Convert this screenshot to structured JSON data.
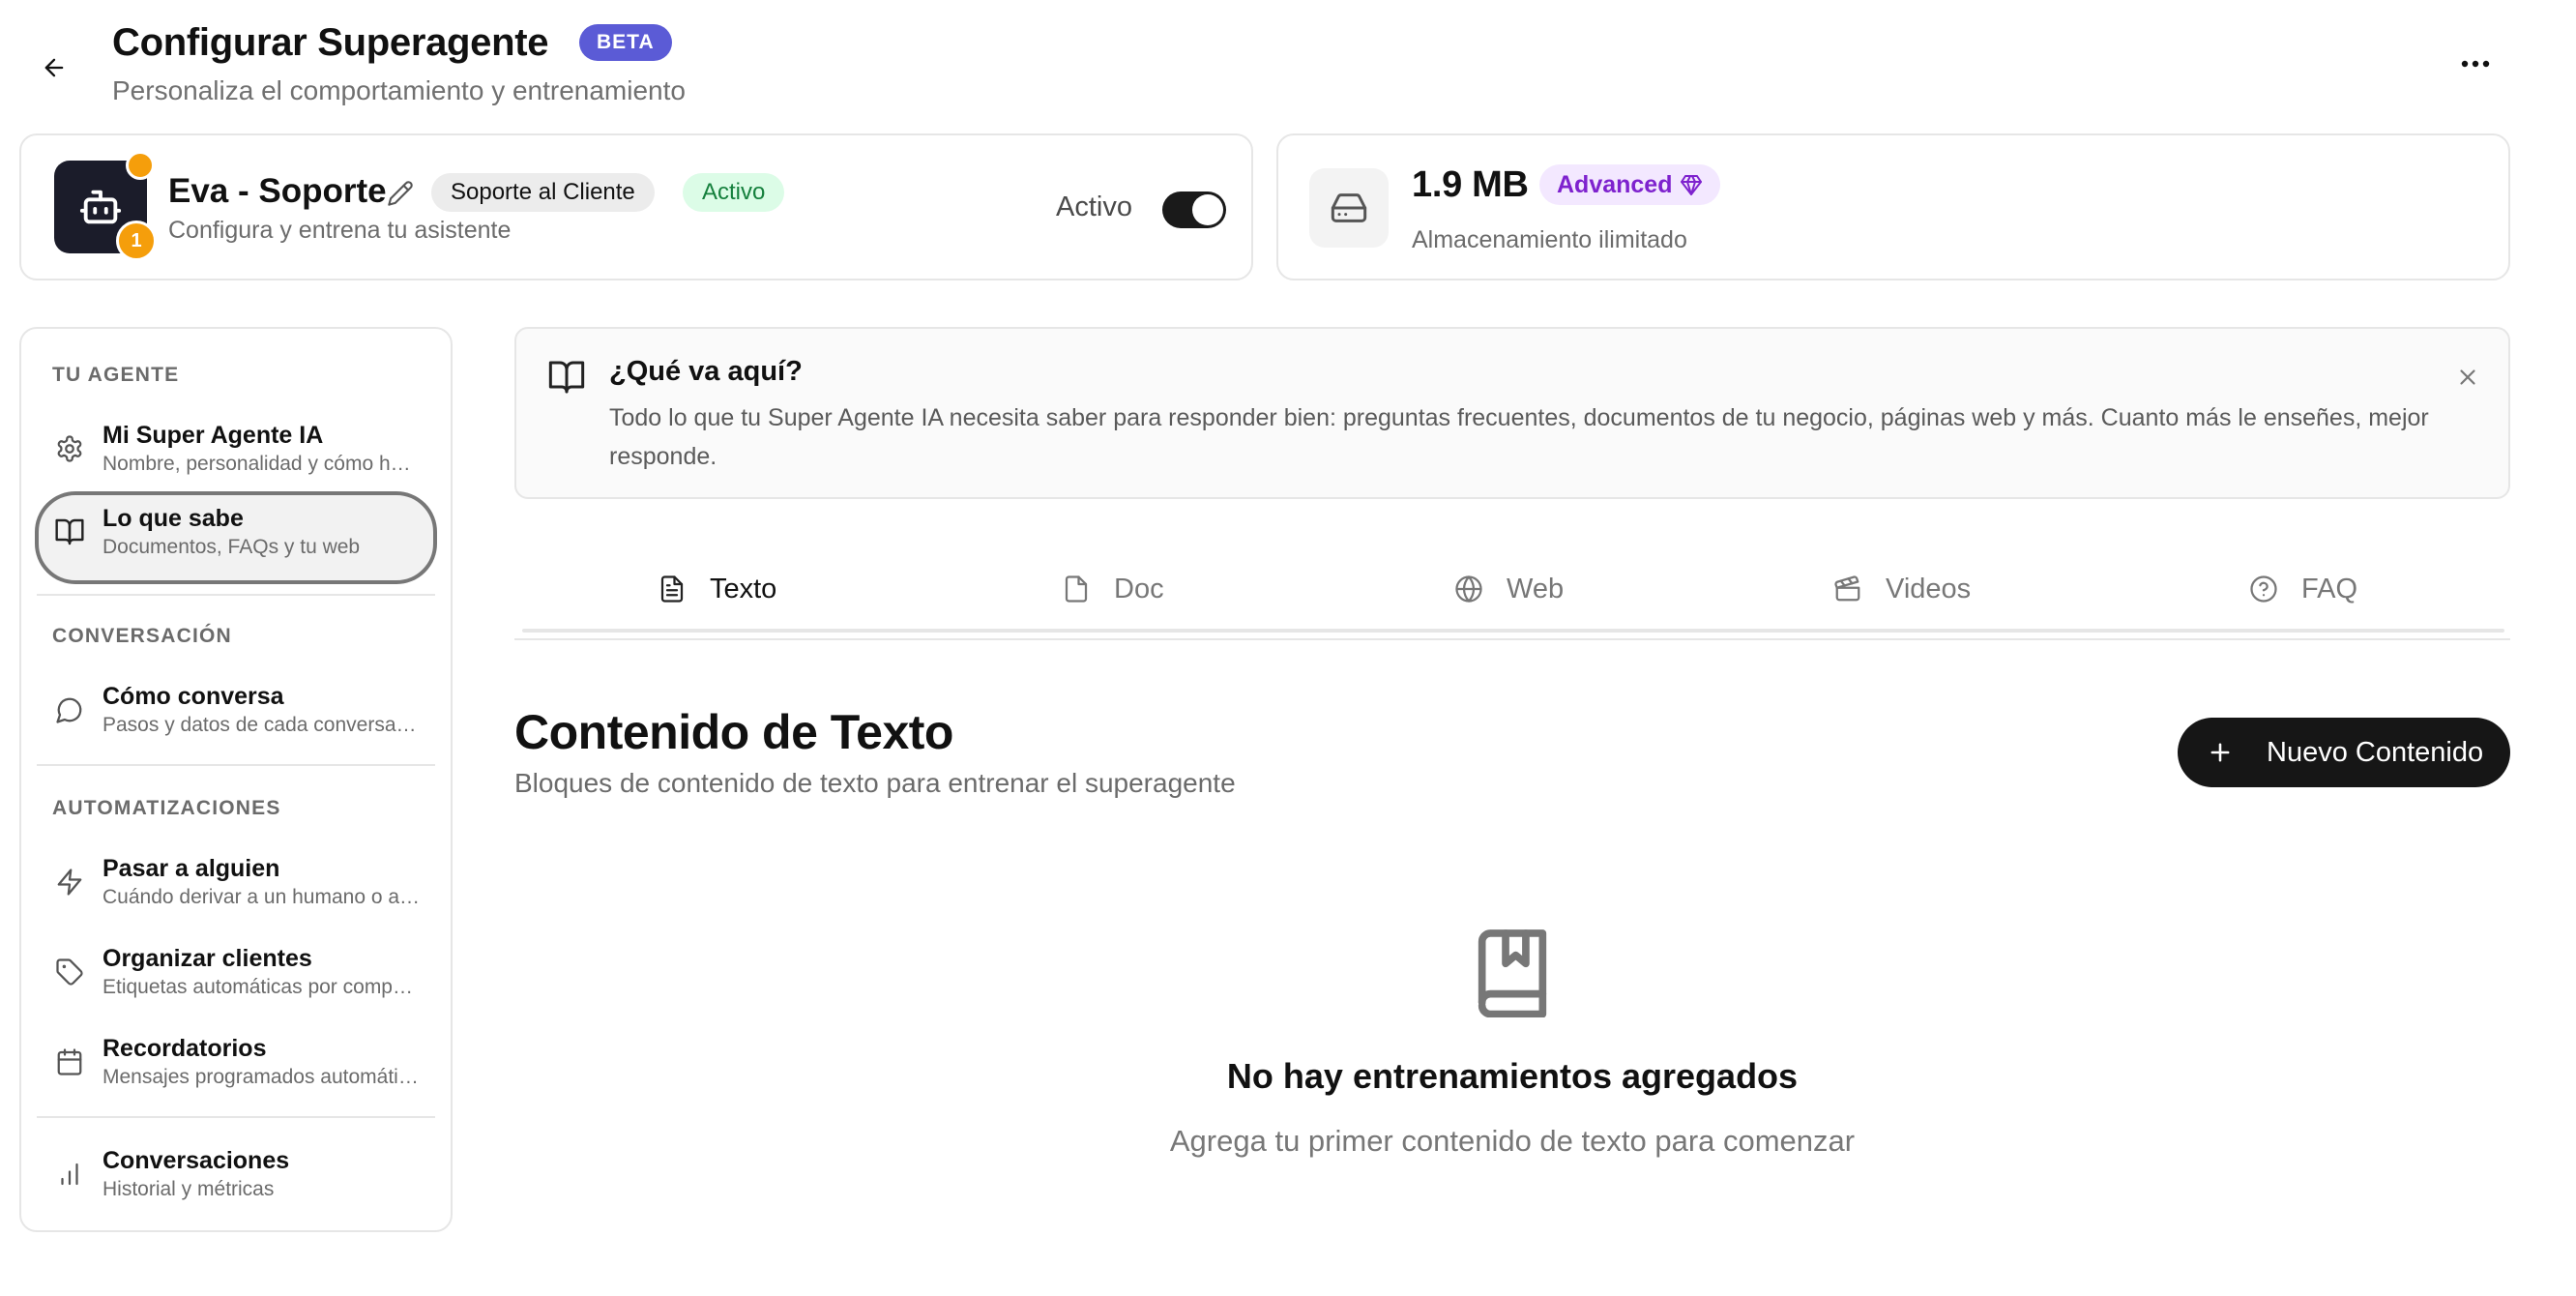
{
  "header": {
    "title": "Configurar Superagente",
    "badge": "BETA",
    "subtitle": "Personaliza el comportamiento y entrenamiento"
  },
  "agent": {
    "name": "Eva - Soporte",
    "category": "Soporte al Cliente",
    "status": "Activo",
    "description": "Configura y entrena tu asistente",
    "notification_count": "1",
    "toggle_label": "Activo",
    "toggle_on": true
  },
  "storage": {
    "size": "1.9 MB",
    "plan": "Advanced",
    "description": "Almacenamiento ilimitado"
  },
  "sidebar": {
    "sections": [
      {
        "label": "TU AGENTE"
      },
      {
        "label": "CONVERSACIÓN"
      },
      {
        "label": "AUTOMATIZACIONES"
      }
    ],
    "items": [
      {
        "title": "Mi Super Agente IA",
        "subtitle": "Nombre, personalidad y cómo habla",
        "icon": "gear-icon"
      },
      {
        "title": "Lo que sabe",
        "subtitle": "Documentos, FAQs y tu web",
        "icon": "book-icon",
        "active": true
      },
      {
        "title": "Cómo conversa",
        "subtitle": "Pasos y datos de cada conversación",
        "icon": "chat-bubble-icon"
      },
      {
        "title": "Pasar a alguien",
        "subtitle": "Cuándo derivar a un humano o agente",
        "icon": "lightning-icon"
      },
      {
        "title": "Organizar clientes",
        "subtitle": "Etiquetas automáticas por comportamiento",
        "icon": "tag-icon"
      },
      {
        "title": "Recordatorios",
        "subtitle": "Mensajes programados automáticamente",
        "icon": "calendar-icon"
      },
      {
        "title": "Conversaciones",
        "subtitle": "Historial y métricas",
        "icon": "bar-chart-icon"
      }
    ]
  },
  "info": {
    "title": "¿Qué va aquí?",
    "text": "Todo lo que tu Super Agente IA necesita saber para responder bien: preguntas frecuentes, documentos de tu negocio, páginas web y más. Cuanto más le enseñes, mejor responde."
  },
  "tabs": [
    {
      "label": "Texto",
      "icon": "file-text-icon",
      "active": true
    },
    {
      "label": "Doc",
      "icon": "file-icon"
    },
    {
      "label": "Web",
      "icon": "globe-icon"
    },
    {
      "label": "Videos",
      "icon": "clapperboard-icon"
    },
    {
      "label": "FAQ",
      "icon": "help-circle-icon"
    }
  ],
  "content": {
    "title": "Contenido de Texto",
    "subtitle": "Bloques de contenido de texto para entrenar el superagente",
    "new_button": "Nuevo Contenido"
  },
  "empty_state": {
    "title": "No hay entrenamientos agregados",
    "subtitle": "Agrega tu primer contenido de texto para comenzar",
    "icon": "book-bookmark-icon"
  },
  "colors": {
    "beta_badge": "#5b5bd6",
    "active_badge_bg": "#dcfce7",
    "active_badge_text": "#15803d",
    "plan_badge_bg": "#f3e8ff",
    "plan_badge_text": "#7e22ce",
    "avatar_bg": "#1b1c2a",
    "notification": "#f59e0b",
    "primary_button": "#161616"
  }
}
